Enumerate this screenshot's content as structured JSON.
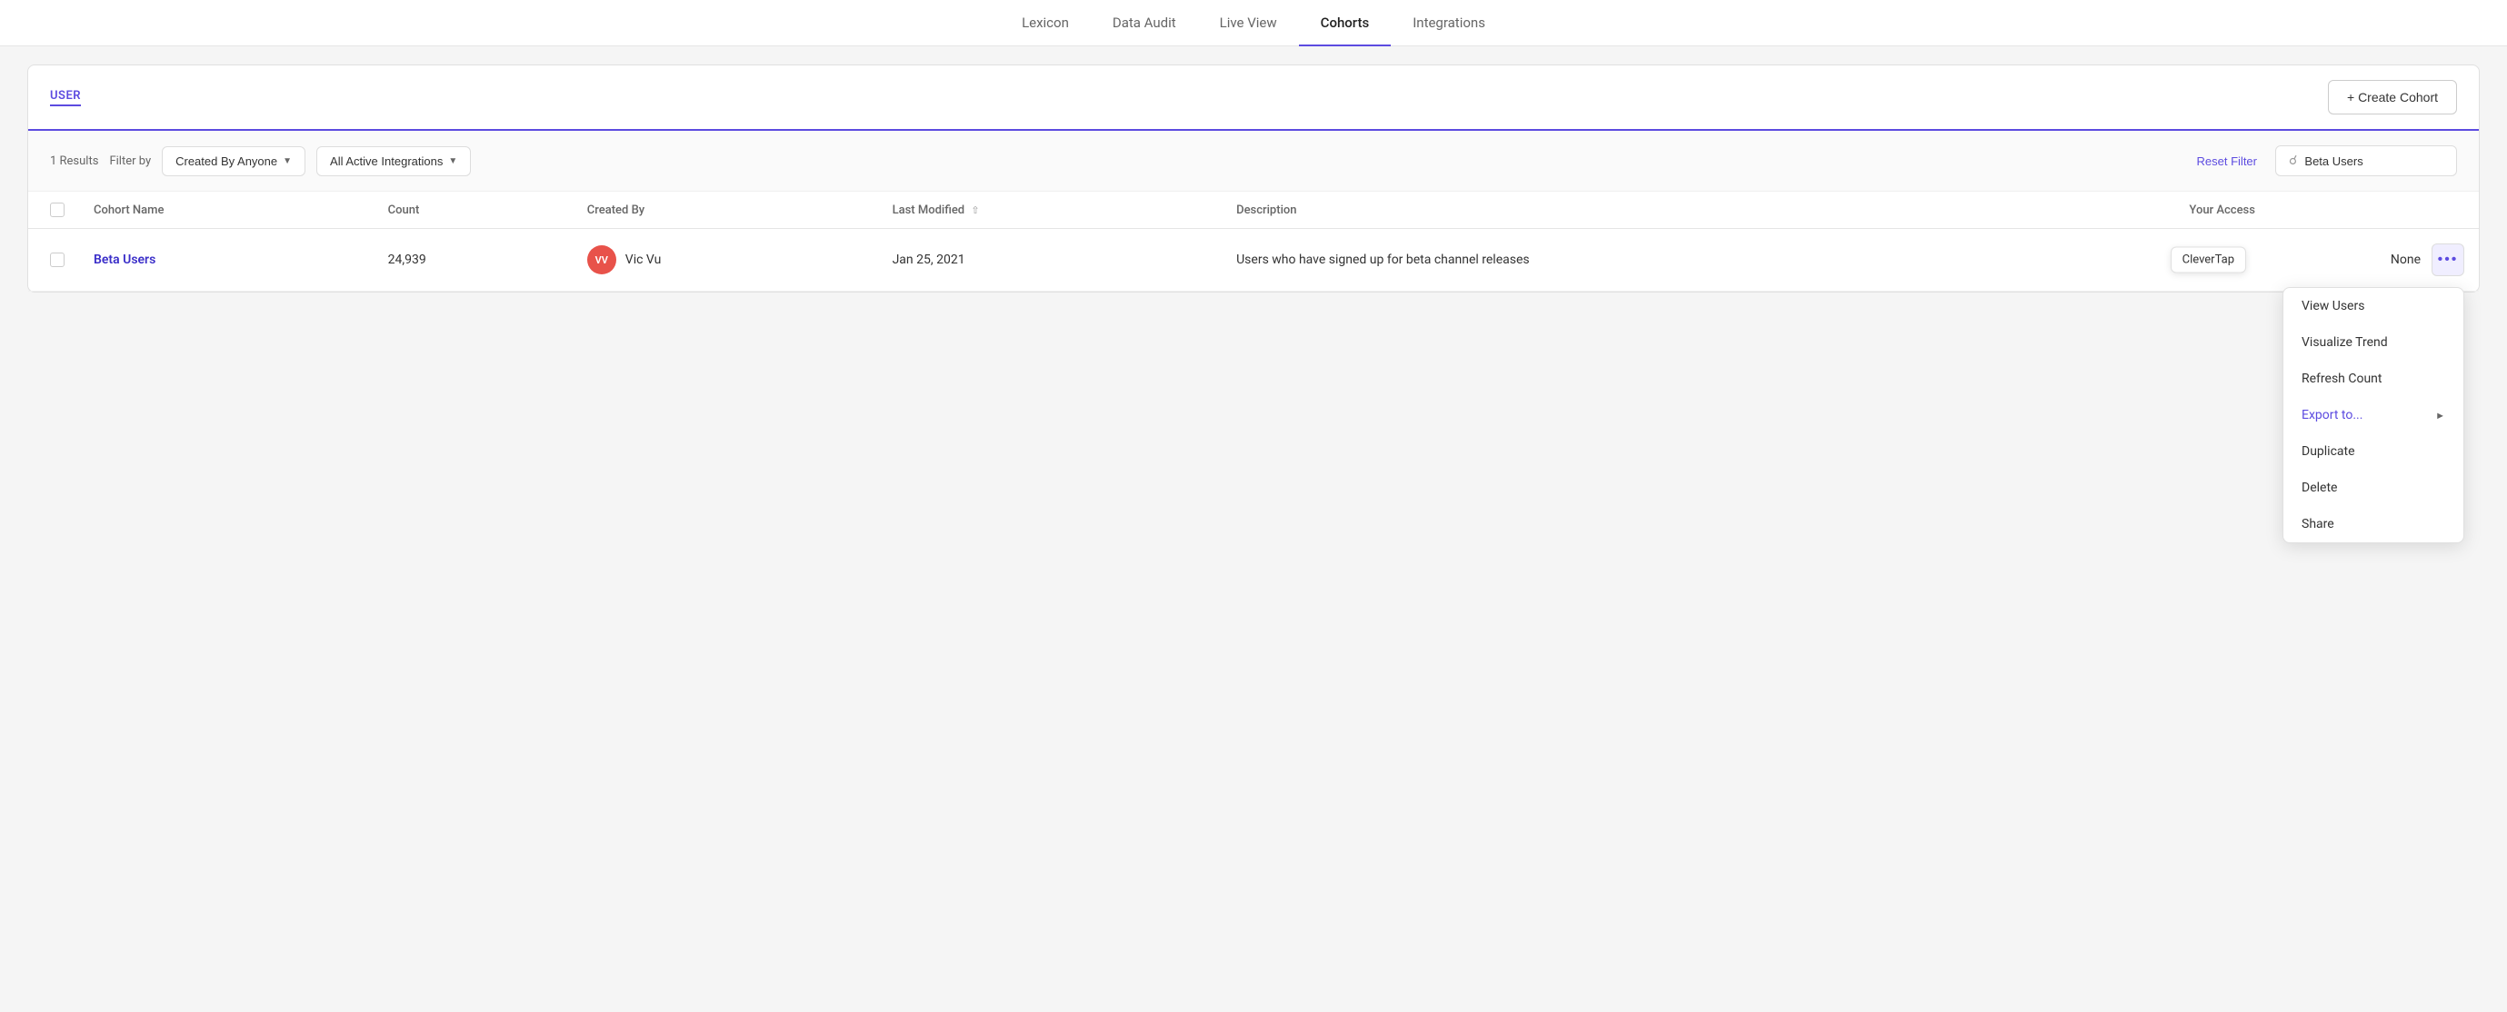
{
  "nav": {
    "items": [
      {
        "label": "Lexicon",
        "active": false
      },
      {
        "label": "Data Audit",
        "active": false
      },
      {
        "label": "Live View",
        "active": false
      },
      {
        "label": "Cohorts",
        "active": true
      },
      {
        "label": "Integrations",
        "active": false
      }
    ]
  },
  "panel": {
    "user_tab": "USER",
    "create_cohort_label": "+ Create Cohort"
  },
  "filters": {
    "results_count": "1 Results",
    "filter_by_label": "Filter by",
    "created_by_label": "Created By Anyone",
    "integrations_label": "All Active Integrations",
    "reset_filter_label": "Reset Filter",
    "search_placeholder": "Beta Users",
    "search_value": "Beta Users"
  },
  "table": {
    "headers": [
      {
        "label": "",
        "key": "checkbox"
      },
      {
        "label": "Cohort Name",
        "key": "name"
      },
      {
        "label": "Count",
        "key": "count"
      },
      {
        "label": "Created By",
        "key": "created_by"
      },
      {
        "label": "Last Modified",
        "key": "last_modified",
        "sortable": true
      },
      {
        "label": "Description",
        "key": "description"
      },
      {
        "label": "Your Access",
        "key": "access"
      }
    ],
    "rows": [
      {
        "name": "Beta Users",
        "count": "24,939",
        "avatar_initials": "VV",
        "created_by_name": "Vic Vu",
        "last_modified": "Jan 25, 2021",
        "description": "Users who have signed up for beta channel releases",
        "access": "None"
      }
    ]
  },
  "context_menu": {
    "items": [
      {
        "label": "View Users",
        "has_arrow": false
      },
      {
        "label": "Visualize Trend",
        "has_arrow": false
      },
      {
        "label": "Refresh Count",
        "has_arrow": false
      },
      {
        "label": "Export to...",
        "has_arrow": true,
        "highlighted": true
      },
      {
        "label": "Duplicate",
        "has_arrow": false
      },
      {
        "label": "Delete",
        "has_arrow": false
      },
      {
        "label": "Share",
        "has_arrow": false
      }
    ]
  },
  "tooltip_badge": {
    "label": "CleverTap"
  },
  "colors": {
    "accent": "#5c4be0",
    "avatar_bg": "#e8524a"
  }
}
